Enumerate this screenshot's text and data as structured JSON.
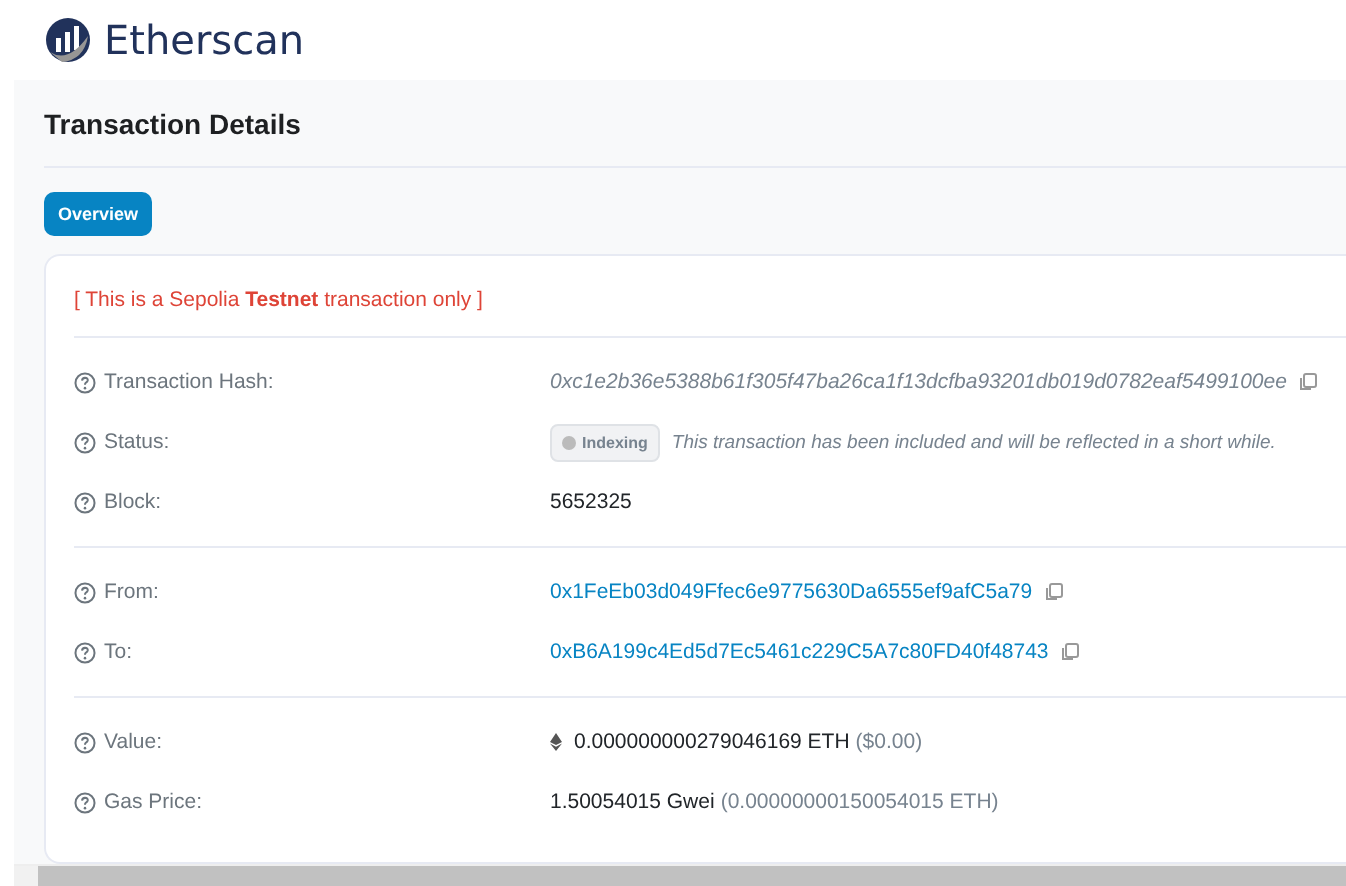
{
  "brand": "Etherscan",
  "title": "Transaction Details",
  "tabs": [
    {
      "label": "Overview",
      "selected": true
    }
  ],
  "notice": "[ This is a Sepolia **Testnet** transaction only ]",
  "sections": [
    {
      "rows": [
        {
          "label": "Transaction Hash:",
          "kind": "hash",
          "value": "0xc1e2b36e5388b61f305f47ba26ca1f13dcfba93201db019d0782eaf5499100ee"
        },
        {
          "label": "Status:",
          "kind": "status",
          "badge": "Indexing",
          "value": "This transaction has been included and will be reflected in a short while."
        },
        {
          "label": "Block:",
          "kind": "text",
          "value": "5652325"
        }
      ]
    },
    {
      "rows": [
        {
          "label": "From:",
          "kind": "link",
          "value": "0x1FeEb03d049Ffec6e9775630Da6555ef9afC5a79"
        },
        {
          "label": "To:",
          "kind": "link",
          "value": "0xB6A199c4Ed5d7Ec5461c229C5A7c80FD40f48743"
        }
      ]
    },
    {
      "rows": [
        {
          "label": "Value:",
          "kind": "amount",
          "value": "0.000000000279046169 ETH",
          "extra": "($0.00)"
        },
        {
          "label": "Gas Price:",
          "kind": "text",
          "value": "1.50054015 Gwei",
          "extra": "(0.00000000150054015 ETH)"
        }
      ]
    }
  ]
}
